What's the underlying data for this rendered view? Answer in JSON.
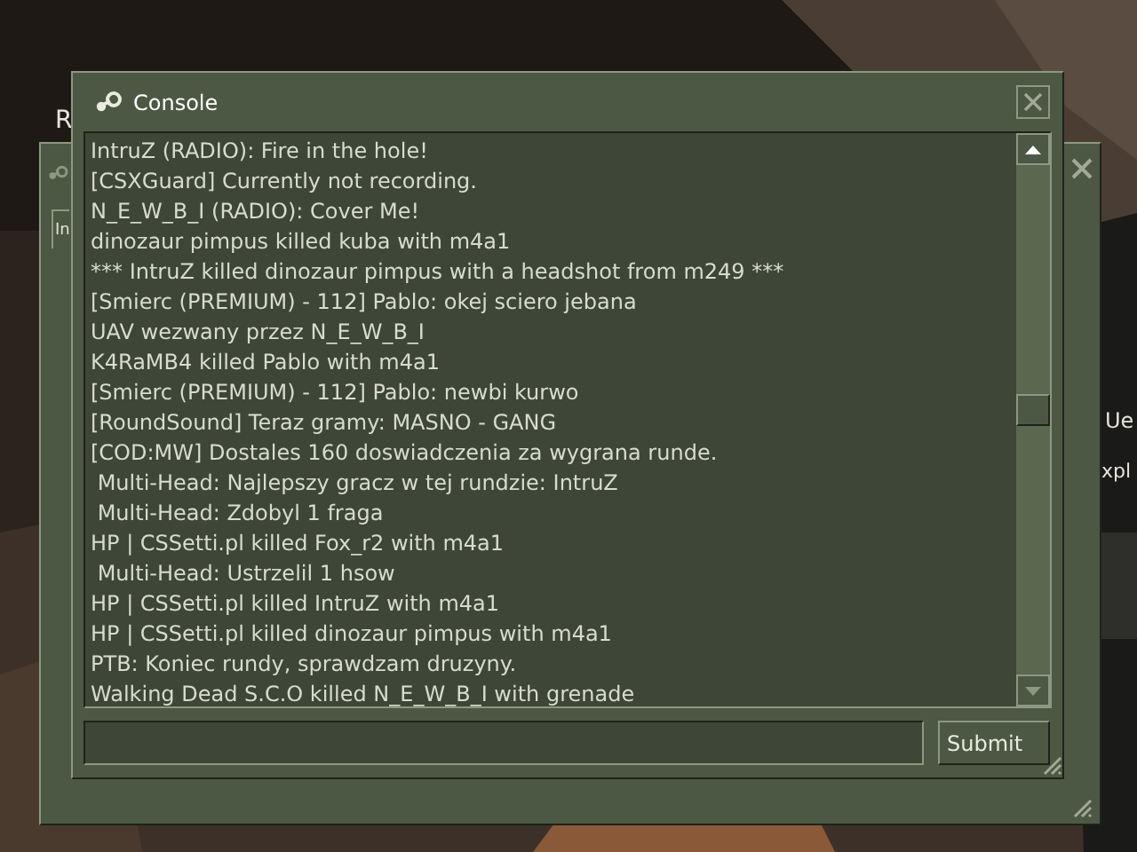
{
  "background": {
    "texts": [
      "R",
      "Ue",
      "xpl"
    ]
  },
  "back_window": {
    "tab": "In"
  },
  "window": {
    "title": "Console"
  },
  "log": [
    "IntruZ (RADIO): Fire in the hole!",
    "[CSXGuard] Currently not recording.",
    "N_E_W_B_I (RADIO): Cover Me!",
    "dinozaur pimpus killed kuba with m4a1",
    "*** IntruZ killed dinozaur pimpus with a headshot from m249 ***",
    "[Smierc (PREMIUM) - 112] Pablo: okej sciero jebana",
    "UAV wezwany przez N_E_W_B_I",
    "K4RaMB4 killed Pablo with m4a1",
    "[Smierc (PREMIUM) - 112] Pablo: newbi kurwo",
    "[RoundSound] Teraz gramy: MASNO - GANG",
    "[COD:MW] Dostales 160 doswiadczenia za wygrana runde.",
    " Multi-Head: Najlepszy gracz w tej rundzie: IntruZ",
    " Multi-Head: Zdobyl 1 fraga",
    "HP | CSSetti.pl killed Fox_r2 with m4a1",
    " Multi-Head: Ustrzelil 1 hsow",
    "HP | CSSetti.pl killed IntruZ with m4a1",
    "HP | CSSetti.pl killed dinozaur pimpus with m4a1",
    "PTB: Koniec rundy, sprawdzam druzyny.",
    "Walking Dead S.C.O killed N_E_W_B_I with grenade"
  ],
  "submit": "Submit"
}
